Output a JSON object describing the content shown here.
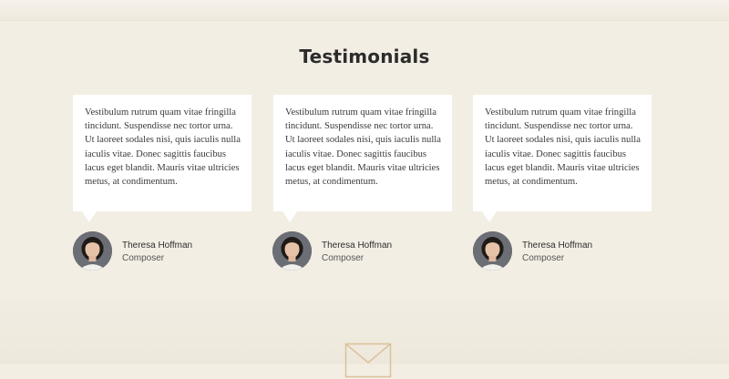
{
  "section": {
    "title": "Testimonials"
  },
  "testimonials": [
    {
      "quote": "Vestibulum rutrum quam vitae fringilla tincidunt. Suspendisse nec tortor urna. Ut laoreet sodales nisi, quis iaculis nulla iaculis vitae. Donec sagittis faucibus lacus eget blandit. Mauris vitae ultricies metus, at condimentum.",
      "name": "Theresa Hoffman",
      "role": "Composer"
    },
    {
      "quote": "Vestibulum rutrum quam vitae fringilla tincidunt. Suspendisse nec tortor urna. Ut laoreet sodales nisi, quis iaculis nulla iaculis vitae. Donec sagittis faucibus lacus eget blandit. Mauris vitae ultricies metus, at condimentum.",
      "name": "Theresa Hoffman",
      "role": "Composer"
    },
    {
      "quote": "Vestibulum rutrum quam vitae fringilla tincidunt. Suspendisse nec tortor urna. Ut laoreet sodales nisi, quis iaculis nulla iaculis vitae. Donec sagittis faucibus lacus eget blandit. Mauris vitae ultricies metus, at condimentum.",
      "name": "Theresa Hoffman",
      "role": "Composer"
    }
  ],
  "icons": {
    "footer": "mail-icon",
    "avatar": "avatar-photo"
  },
  "colors": {
    "background": "#f3eee4",
    "card": "#ffffff",
    "accent": "#d9c29a"
  }
}
